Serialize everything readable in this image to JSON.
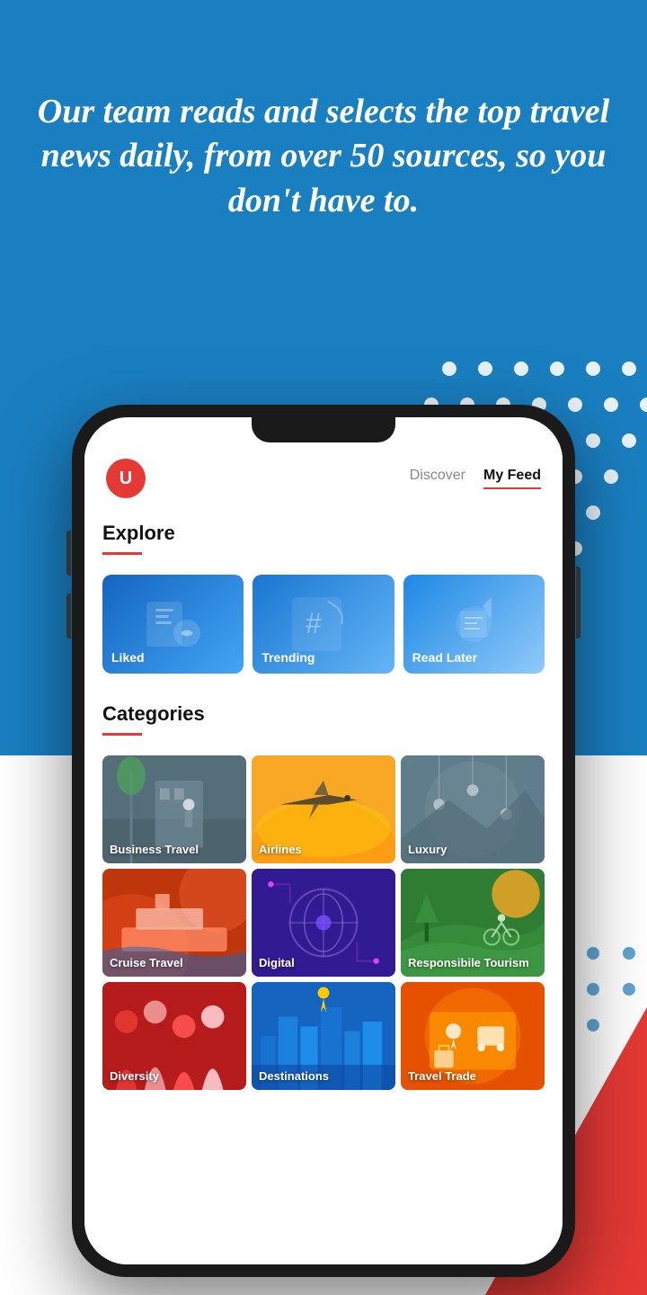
{
  "hero": {
    "text": "Our team reads and selects the top travel news daily, from over 50 sources, so you don't have to."
  },
  "app": {
    "logo": "U",
    "nav": {
      "tabs": [
        {
          "label": "Discover",
          "active": false
        },
        {
          "label": "My Feed",
          "active": true
        }
      ]
    },
    "explore": {
      "title": "Explore",
      "cards": [
        {
          "label": "Liked",
          "class": "card-liked"
        },
        {
          "label": "Trending",
          "class": "card-trending"
        },
        {
          "label": "Read Later",
          "class": "card-readlater"
        }
      ]
    },
    "categories": {
      "title": "Categories",
      "items": [
        {
          "label": "Business Travel",
          "class": "cat-business"
        },
        {
          "label": "Airlines",
          "class": "cat-airlines"
        },
        {
          "label": "Luxury",
          "class": "cat-luxury"
        },
        {
          "label": "Cruise Travel",
          "class": "cat-cruise"
        },
        {
          "label": "Digital",
          "class": "cat-digital"
        },
        {
          "label": "Responsibile Tourism",
          "class": "cat-responsible"
        },
        {
          "label": "Diversity",
          "class": "cat-diversity"
        },
        {
          "label": "Destinations",
          "class": "cat-destinations"
        },
        {
          "label": "Travel Trade",
          "class": "cat-trade"
        }
      ]
    }
  }
}
